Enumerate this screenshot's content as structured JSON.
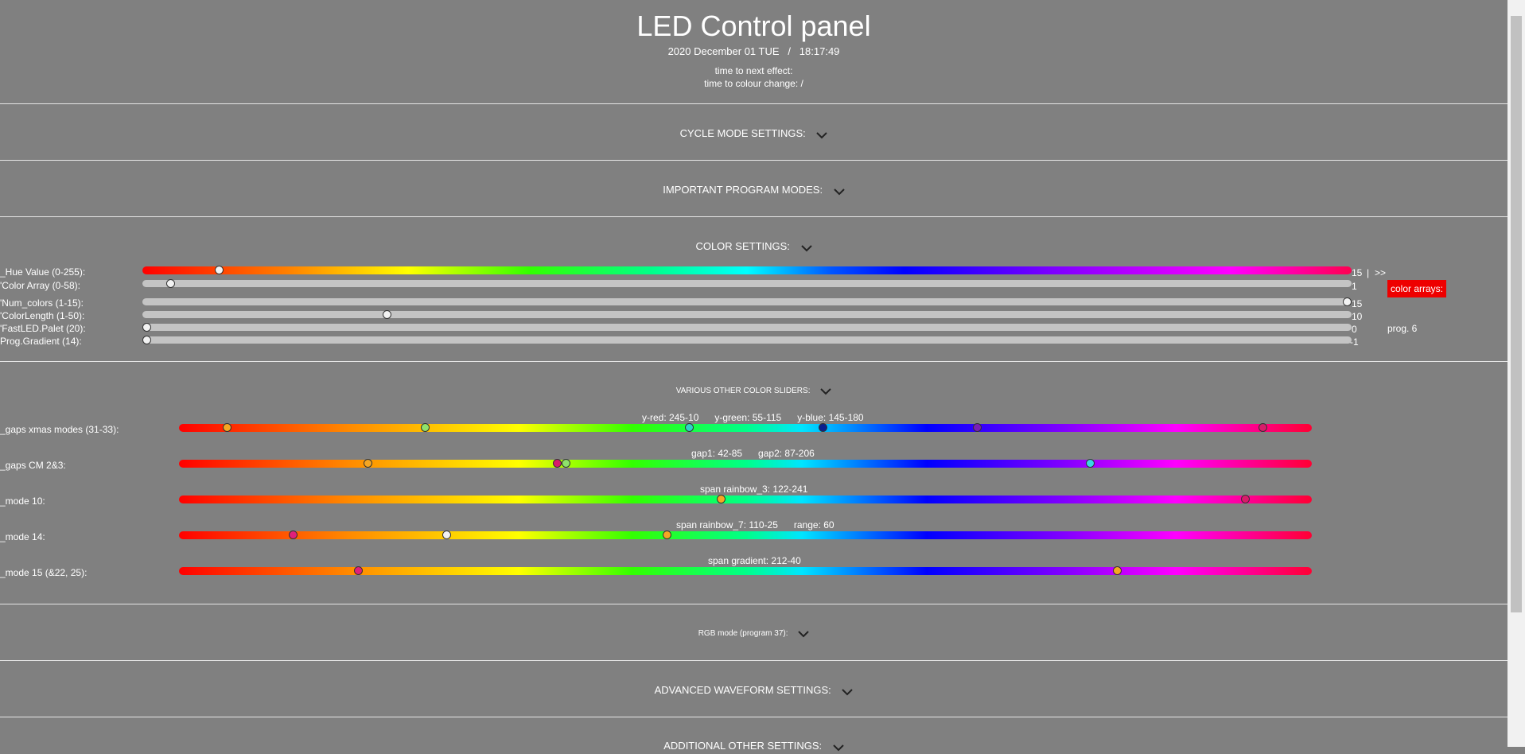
{
  "header": {
    "title": "LED Control panel",
    "datetime": "2020 December 01 TUE   /   18:17:49",
    "time_next_effect": "time to next effect:",
    "time_colour_change": "time to colour change: /"
  },
  "sections": {
    "cycle": "CYCLE MODE SETTINGS:",
    "important": "IMPORTANT PROGRAM MODES:",
    "color": "COLOR SETTINGS:",
    "various": "VARIOUS OTHER COLOR SLIDERS:",
    "rgb": "RGB mode (program 37):",
    "advanced": "ADVANCED WAVEFORM SETTINGS:",
    "additional": "ADDITIONAL OTHER SETTINGS:"
  },
  "color_settings": {
    "hue": {
      "label": "_Hue Value (0-255):",
      "value": "15",
      "sep": "|",
      "next": ">>",
      "level": 0.06
    },
    "color_array": {
      "label": "'Color Array (0-58):",
      "value": "1",
      "level": 0.02
    },
    "num_colors": {
      "label": "'Num_colors (1-15):",
      "value": "15",
      "level": 1.0
    },
    "color_length": {
      "label": "'ColorLength (1-50):",
      "value": "10",
      "level": 0.2
    },
    "fastled_palet": {
      "label": "'FastLED.Palet (20):",
      "value": "0",
      "level": 0.0
    },
    "prog_gradient": {
      "label": "Prog.Gradient (14):",
      "value": "-1",
      "level": 0.0
    },
    "color_arrays_badge": "color arrays:",
    "prog_label": "prog. 6"
  },
  "various": {
    "gaps_xmas": {
      "label": "_gaps xmas modes (31-33):",
      "caption": "y-red: 245-10      y-green: 55-115      y-blue: 145-180",
      "knobs": [
        {
          "p": 0.043,
          "c": "#f5a623"
        },
        {
          "p": 0.218,
          "c": "#8fe36a"
        },
        {
          "p": 0.451,
          "c": "#2ed3c6"
        },
        {
          "p": 0.569,
          "c": "#0a1f8f"
        },
        {
          "p": 0.705,
          "c": "#7a1fb5"
        },
        {
          "p": 0.957,
          "c": "#d81c6a"
        }
      ]
    },
    "gaps_cm": {
      "label": "_gaps CM 2&3:",
      "caption": "gap1: 42-85      gap2: 87-206",
      "knobs": [
        {
          "p": 0.167,
          "c": "#f5a623"
        },
        {
          "p": 0.334,
          "c": "#d81c6a"
        },
        {
          "p": 0.342,
          "c": "#8fe36a"
        },
        {
          "p": 0.805,
          "c": "#3ad6e8"
        }
      ]
    },
    "mode10": {
      "label": "_mode 10:",
      "caption": "span rainbow_3: 122-241",
      "knobs": [
        {
          "p": 0.479,
          "c": "#f5a623"
        },
        {
          "p": 0.942,
          "c": "#d81c6a"
        }
      ]
    },
    "mode14": {
      "label": "_mode 14:",
      "caption": "span rainbow_7: 110-25      range: 60",
      "knobs": [
        {
          "p": 0.101,
          "c": "#e0207a"
        },
        {
          "p": 0.237,
          "c": "#f2f2f2"
        },
        {
          "p": 0.431,
          "c": "#f5a623"
        }
      ]
    },
    "mode15": {
      "label": "_mode 15 (&22, 25):",
      "caption": "span gradient: 212-40",
      "knobs": [
        {
          "p": 0.159,
          "c": "#e0207a"
        },
        {
          "p": 0.829,
          "c": "#f5a623"
        }
      ]
    }
  },
  "colors": {
    "background": "#808080",
    "badge": "#ee0000",
    "slider_track": "#c4c4c4"
  }
}
